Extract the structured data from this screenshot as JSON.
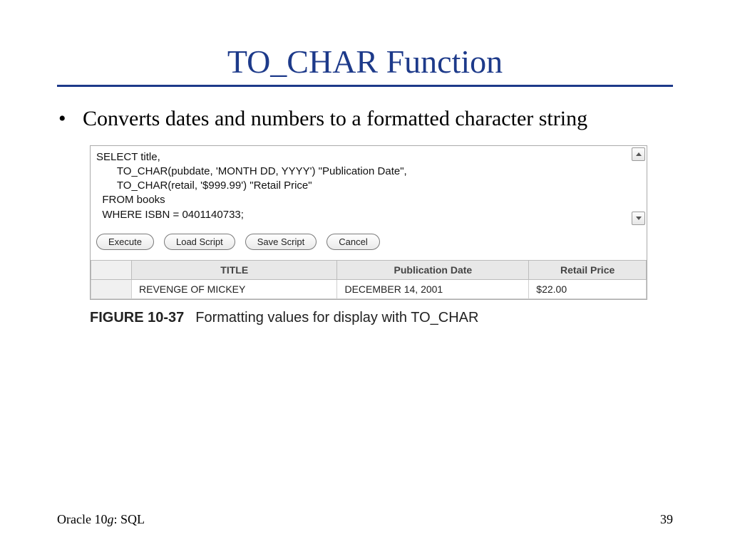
{
  "title": "TO_CHAR Function",
  "bullet": "Converts dates and numbers to a formatted character string",
  "sql": "SELECT title,\n       TO_CHAR(pubdate, 'MONTH DD, YYYY') \"Publication Date\",\n       TO_CHAR(retail, '$999.99') \"Retail Price\"\n  FROM books\n  WHERE ISBN = 0401140733;",
  "buttons": {
    "execute": "Execute",
    "load": "Load Script",
    "save": "Save Script",
    "cancel": "Cancel"
  },
  "table": {
    "headers": {
      "c1": "TITLE",
      "c2": "Publication Date",
      "c3": "Retail Price"
    },
    "row": {
      "c1": "REVENGE OF MICKEY",
      "c2": "DECEMBER  14, 2001",
      "c3": "$22.00"
    }
  },
  "figure": {
    "num": "FIGURE 10-37",
    "caption": "Formatting values for display with TO_CHAR"
  },
  "footer": {
    "left_a": "Oracle 10",
    "left_b": "g",
    "left_c": ": SQL",
    "page": "39"
  }
}
